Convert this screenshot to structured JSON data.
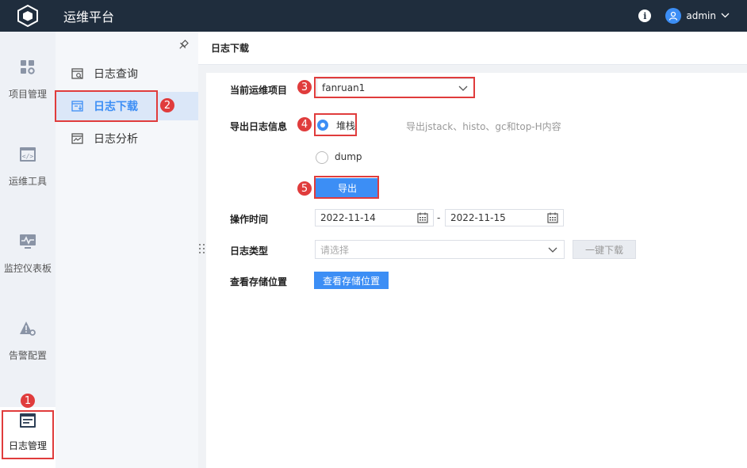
{
  "header": {
    "title": "运维平台",
    "info_icon": "info-icon",
    "user": "admin"
  },
  "nav1": {
    "items": [
      {
        "label": "项目管理",
        "icon": "grid-gear-icon"
      },
      {
        "label": "运维工具",
        "icon": "code-window-icon"
      },
      {
        "label": "监控仪表板",
        "icon": "monitor-pulse-icon"
      },
      {
        "label": "告警配置",
        "icon": "warning-gear-icon"
      },
      {
        "label": "日志管理",
        "icon": "log-window-icon",
        "active": true
      }
    ]
  },
  "nav2": {
    "items": [
      {
        "label": "日志查询",
        "icon": "log-search-icon"
      },
      {
        "label": "日志下载",
        "icon": "log-download-icon",
        "active": true
      },
      {
        "label": "日志分析",
        "icon": "log-analysis-icon"
      }
    ]
  },
  "main": {
    "title": "日志下载",
    "project": {
      "label": "当前运维项目",
      "value": "fanruan1"
    },
    "export": {
      "label": "导出日志信息",
      "options": [
        {
          "label": "堆栈",
          "checked": true
        },
        {
          "label": "dump",
          "checked": false
        }
      ],
      "hint": "导出jstack、histo、gc和top-H内容",
      "button": "导出"
    },
    "time": {
      "label": "操作时间",
      "start": "2022-11-14",
      "end": "2022-11-15",
      "separator": "-"
    },
    "logtype": {
      "label": "日志类型",
      "placeholder": "请选择",
      "button": "一键下载"
    },
    "storage": {
      "label": "查看存储位置",
      "button": "查看存储位置"
    }
  },
  "annotations": [
    "1",
    "2",
    "3",
    "4",
    "5"
  ],
  "colors": {
    "topbar": "#1f2d3d",
    "accent": "#3c8ef5",
    "annotation": "#e03c3c"
  }
}
